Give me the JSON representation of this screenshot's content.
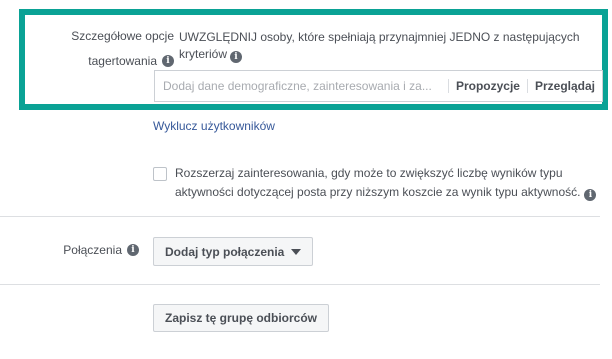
{
  "targeting": {
    "label_line1": "Szczegółowe opcje",
    "label_line2": "tagertowania",
    "include_text": "UWZGLĘDNIJ osoby, które spełniają przynajmniej JEDNO z następujących kryteriów",
    "search_placeholder": "Dodaj dane demograficzne, zainteresowania i za...",
    "suggestions_label": "Propozycje",
    "browse_label": "Przeglądaj",
    "highlight_color": "#0aa295"
  },
  "exclude": {
    "link_text": "Wyklucz użytkowników",
    "link_color": "#365899"
  },
  "expand_interests": {
    "checked": false,
    "text": "Rozszerzaj zainteresowania, gdy może to zwiększyć liczbę wyników typu aktywności dotyczącej posta przy niższym koszcie za wynik typu aktywność."
  },
  "connections": {
    "label": "Połączenia",
    "add_button_label": "Dodaj typ połączenia"
  },
  "save_audience": {
    "button_label": "Zapisz tę grupę odbiorców"
  },
  "icons": {
    "info": "info-icon",
    "dropdown": "caret-down-icon"
  }
}
